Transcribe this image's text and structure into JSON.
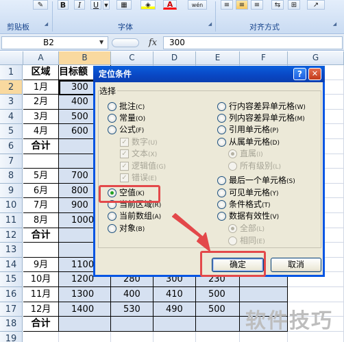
{
  "ribbon": {
    "groups": [
      "剪贴板",
      "字体",
      "对齐方式"
    ],
    "bold_glyph": "B",
    "italic_glyph": "I",
    "underline_glyph": "U",
    "phonetic_glyph": "wén"
  },
  "formula_bar": {
    "name_box": "B2",
    "fx": "fx",
    "formula": "300"
  },
  "grid": {
    "columns": [
      "A",
      "B",
      "C",
      "D",
      "E",
      "F",
      "G"
    ],
    "rows": [
      "1",
      "2",
      "3",
      "4",
      "5",
      "6",
      "7",
      "8",
      "9",
      "10",
      "11",
      "12",
      "13",
      "14",
      "15",
      "16",
      "17",
      "18",
      "19"
    ],
    "header": [
      "区域",
      "目标额"
    ],
    "col_a": [
      "1月",
      "2月",
      "3月",
      "4月",
      "合计",
      "",
      "5月",
      "6月",
      "7月",
      "8月",
      "合计",
      "",
      "9月",
      "10月",
      "11月",
      "12月",
      "合计"
    ],
    "col_b": [
      "300",
      "400",
      "500",
      "600",
      "",
      "",
      "700",
      "800",
      "900",
      "1000",
      "",
      "",
      "1100",
      "1200",
      "1300",
      "1400",
      ""
    ],
    "row15": [
      "",
      "280",
      "300",
      "230"
    ],
    "row16": [
      "",
      "400",
      "410",
      "500"
    ],
    "row17": [
      "",
      "530",
      "490",
      "500"
    ]
  },
  "dialog": {
    "title": "定位条件",
    "help": "?",
    "close": "✕",
    "group": "选择",
    "left_options": [
      {
        "text": "批注",
        "key": "(C)"
      },
      {
        "text": "常量",
        "key": "(O)"
      },
      {
        "text": "公式",
        "key": "(F)"
      },
      {
        "text": "数字",
        "key": "(U)"
      },
      {
        "text": "文本",
        "key": "(X)"
      },
      {
        "text": "逻辑值",
        "key": "(G)"
      },
      {
        "text": "错误",
        "key": "(E)"
      },
      {
        "text": "空值",
        "key": "(K)"
      },
      {
        "text": "当前区域",
        "key": "(R)"
      },
      {
        "text": "当前数组",
        "key": "(A)"
      },
      {
        "text": "对象",
        "key": "(B)"
      }
    ],
    "right_options": [
      {
        "text": "行内容差异单元格",
        "key": "(W)"
      },
      {
        "text": "列内容差异单元格",
        "key": "(M)"
      },
      {
        "text": "引用单元格",
        "key": "(P)"
      },
      {
        "text": "从属单元格",
        "key": "(D)"
      },
      {
        "text": "直属",
        "key": "(I)"
      },
      {
        "text": "所有级别",
        "key": "(L)"
      },
      {
        "text": "最后一个单元格",
        "key": "(S)"
      },
      {
        "text": "可见单元格",
        "key": "(Y)"
      },
      {
        "text": "条件格式",
        "key": "(T)"
      },
      {
        "text": "数据有效性",
        "key": "(V)"
      },
      {
        "text": "全部",
        "key": "(L)"
      },
      {
        "text": "相同",
        "key": "(E)"
      }
    ],
    "ok": "确定",
    "cancel": "取消"
  },
  "watermark": "软件技巧",
  "colors": {
    "highlight": "#e3484a",
    "title_bar": "#0a5fdc",
    "selection": "#d6e1f1"
  }
}
